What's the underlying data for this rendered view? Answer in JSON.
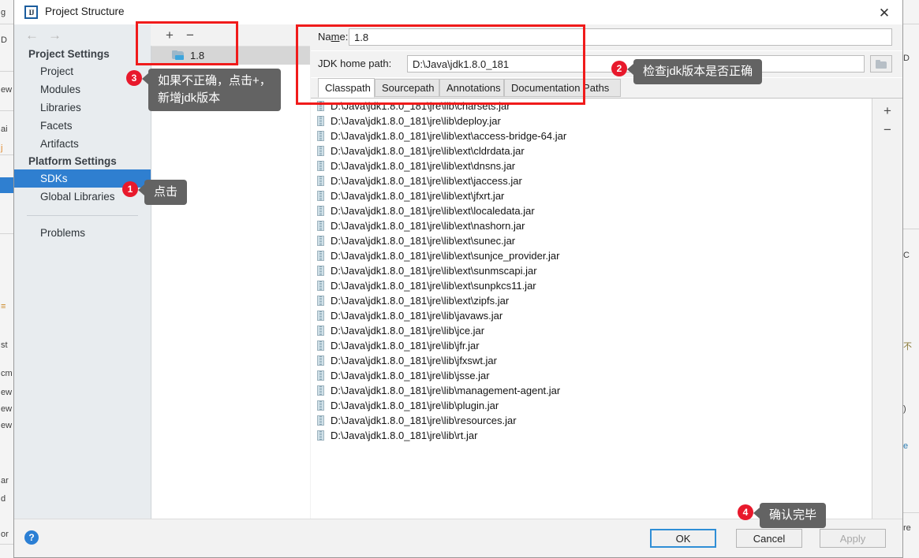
{
  "window": {
    "title": "Project Structure",
    "app_icon": "intellij-idea-icon",
    "close_label": "✕"
  },
  "nav": {
    "back_icon": "←",
    "forward_icon": "→"
  },
  "sidebar": {
    "groups": [
      {
        "header": "Project Settings",
        "items": [
          {
            "label": "Project",
            "selected": false
          },
          {
            "label": "Modules",
            "selected": false
          },
          {
            "label": "Libraries",
            "selected": false
          },
          {
            "label": "Facets",
            "selected": false
          },
          {
            "label": "Artifacts",
            "selected": false
          }
        ]
      },
      {
        "header": "Platform Settings",
        "items": [
          {
            "label": "SDKs",
            "selected": true
          },
          {
            "label": "Global Libraries",
            "selected": false
          }
        ]
      }
    ],
    "footer_items": [
      {
        "label": "Problems",
        "selected": false
      }
    ]
  },
  "sdk_panel": {
    "toolbar": {
      "add_label": "+",
      "remove_label": "−"
    },
    "items": [
      {
        "label": "1.8",
        "selected": true
      }
    ]
  },
  "detail": {
    "name_label": "Name:",
    "name_label_prefix": "Na",
    "name_label_mnemonic": "m",
    "name_label_suffix": "e:",
    "name_value": "1.8",
    "path_label": "JDK home path:",
    "path_value": "D:\\Java\\jdk1.8.0_181",
    "browse_icon": "folder-icon",
    "tabs": [
      {
        "label": "Classpath",
        "active": true
      },
      {
        "label": "Sourcepath",
        "active": false
      },
      {
        "label": "Annotations",
        "active": false
      },
      {
        "label": "Documentation Paths",
        "active": false
      }
    ],
    "list_toolbar": {
      "add_label": "+",
      "remove_label": "−"
    },
    "classpath_entries": [
      "D:\\Java\\jdk1.8.0_181\\jre\\lib\\charsets.jar",
      "D:\\Java\\jdk1.8.0_181\\jre\\lib\\deploy.jar",
      "D:\\Java\\jdk1.8.0_181\\jre\\lib\\ext\\access-bridge-64.jar",
      "D:\\Java\\jdk1.8.0_181\\jre\\lib\\ext\\cldrdata.jar",
      "D:\\Java\\jdk1.8.0_181\\jre\\lib\\ext\\dnsns.jar",
      "D:\\Java\\jdk1.8.0_181\\jre\\lib\\ext\\jaccess.jar",
      "D:\\Java\\jdk1.8.0_181\\jre\\lib\\ext\\jfxrt.jar",
      "D:\\Java\\jdk1.8.0_181\\jre\\lib\\ext\\localedata.jar",
      "D:\\Java\\jdk1.8.0_181\\jre\\lib\\ext\\nashorn.jar",
      "D:\\Java\\jdk1.8.0_181\\jre\\lib\\ext\\sunec.jar",
      "D:\\Java\\jdk1.8.0_181\\jre\\lib\\ext\\sunjce_provider.jar",
      "D:\\Java\\jdk1.8.0_181\\jre\\lib\\ext\\sunmscapi.jar",
      "D:\\Java\\jdk1.8.0_181\\jre\\lib\\ext\\sunpkcs11.jar",
      "D:\\Java\\jdk1.8.0_181\\jre\\lib\\ext\\zipfs.jar",
      "D:\\Java\\jdk1.8.0_181\\jre\\lib\\javaws.jar",
      "D:\\Java\\jdk1.8.0_181\\jre\\lib\\jce.jar",
      "D:\\Java\\jdk1.8.0_181\\jre\\lib\\jfr.jar",
      "D:\\Java\\jdk1.8.0_181\\jre\\lib\\jfxswt.jar",
      "D:\\Java\\jdk1.8.0_181\\jre\\lib\\jsse.jar",
      "D:\\Java\\jdk1.8.0_181\\jre\\lib\\management-agent.jar",
      "D:\\Java\\jdk1.8.0_181\\jre\\lib\\plugin.jar",
      "D:\\Java\\jdk1.8.0_181\\jre\\lib\\resources.jar",
      "D:\\Java\\jdk1.8.0_181\\jre\\lib\\rt.jar"
    ]
  },
  "bottom_bar": {
    "help_label": "?",
    "ok_label": "OK",
    "cancel_label": "Cancel",
    "apply_label": "Apply"
  },
  "annotations": {
    "callout_1": {
      "number": "1",
      "text": "点击"
    },
    "callout_2": {
      "number": "2",
      "text": "检查jdk版本是否正确"
    },
    "callout_3": {
      "number": "3",
      "text": "如果不正确，点击+，\n新增jdk版本"
    },
    "callout_4": {
      "number": "4",
      "text": "确认完毕"
    },
    "box_color": "#f01b1b",
    "badge_color": "#e8192c",
    "bubble_color": "#636363"
  },
  "background_window": {
    "left_fragments": [
      "g",
      "D",
      "ew",
      "ai",
      "j",
      "st",
      "cm",
      "ew",
      "ew",
      "ew",
      "ar",
      "d",
      "or"
    ],
    "right_fragments": [
      "✕",
      "D",
      "+",
      "−",
      "C",
      "不",
      ")",
      "e",
      "re"
    ]
  },
  "colors": {
    "accent_blue": "#2f7fd0",
    "selected_row": "#d6d6d6",
    "annotation_red": "#f01b1b",
    "ok_border": "#2f8ed6"
  }
}
